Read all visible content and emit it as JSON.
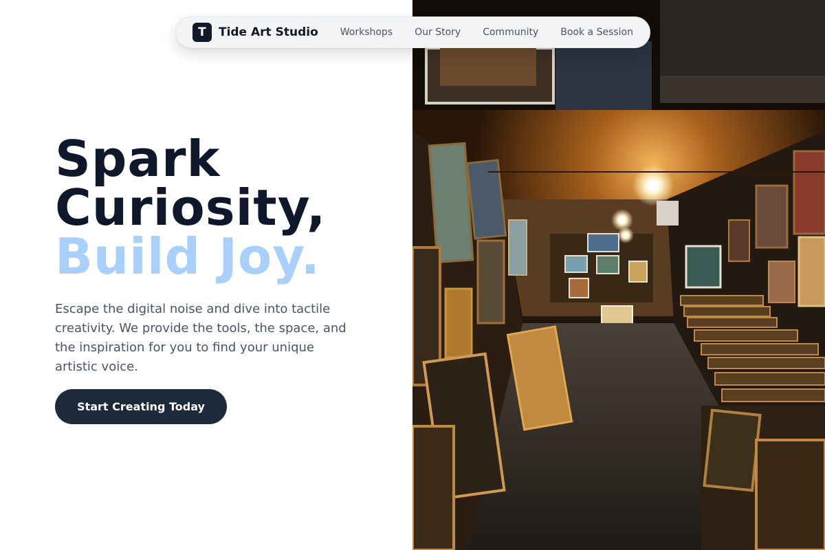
{
  "nav": {
    "logo_letter": "T",
    "brand": "Tide Art Studio",
    "links": [
      {
        "label": "Workshops"
      },
      {
        "label": "Our Story"
      },
      {
        "label": "Community"
      },
      {
        "label": "Book a Session"
      }
    ]
  },
  "hero": {
    "title_line1": "Spark",
    "title_line2": "Curiosity,",
    "title_line3": "Build Joy.",
    "subtitle": "Escape the digital noise and dive into tactile creativity. We provide the tools, the space, and the inspiration for you to find your unique artistic voice.",
    "cta_label": "Start Creating Today"
  },
  "colors": {
    "accent": "#a8d0fa",
    "heading": "#0f172a",
    "button": "#1e293b"
  },
  "image": {
    "icon": "art-gallery-photo"
  }
}
